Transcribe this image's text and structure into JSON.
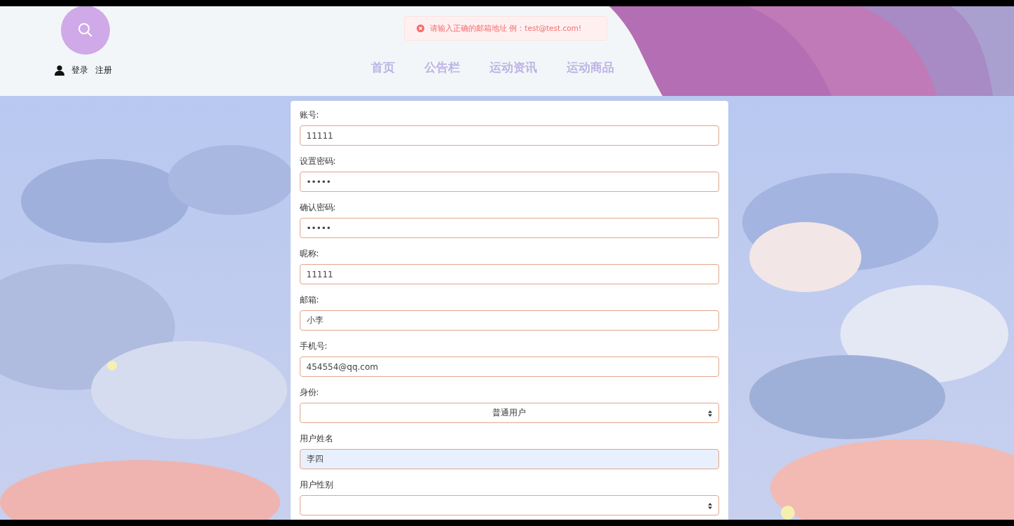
{
  "header": {
    "auth_links": [
      "登录",
      "注册"
    ],
    "nav": [
      {
        "label": "首页"
      },
      {
        "label": "公告栏"
      },
      {
        "label": "运动资讯"
      },
      {
        "label": "运动商品"
      }
    ]
  },
  "toast": {
    "kind": "error",
    "message": "请输入正确的邮箱地址 例：test@test.com!"
  },
  "form": {
    "fields": [
      {
        "label": "账号:",
        "kind": "text",
        "value": "11111",
        "autofilled": false
      },
      {
        "label": "设置密码:",
        "kind": "text",
        "value": "•••••",
        "autofilled": false
      },
      {
        "label": "确认密码:",
        "kind": "text",
        "value": "•••••",
        "autofilled": false
      },
      {
        "label": "昵称:",
        "kind": "text",
        "value": "11111",
        "autofilled": false
      },
      {
        "label": "邮箱:",
        "kind": "text",
        "value": "小李",
        "autofilled": false
      },
      {
        "label": "手机号:",
        "kind": "text",
        "value": "454554@qq.com",
        "autofilled": false
      },
      {
        "label": "身份:",
        "kind": "select",
        "value": "普通用户",
        "autofilled": false
      },
      {
        "label": "用户姓名",
        "kind": "text",
        "value": "李四",
        "autofilled": true
      },
      {
        "label": "用户性别",
        "kind": "select",
        "autofilled": false
      }
    ]
  }
}
